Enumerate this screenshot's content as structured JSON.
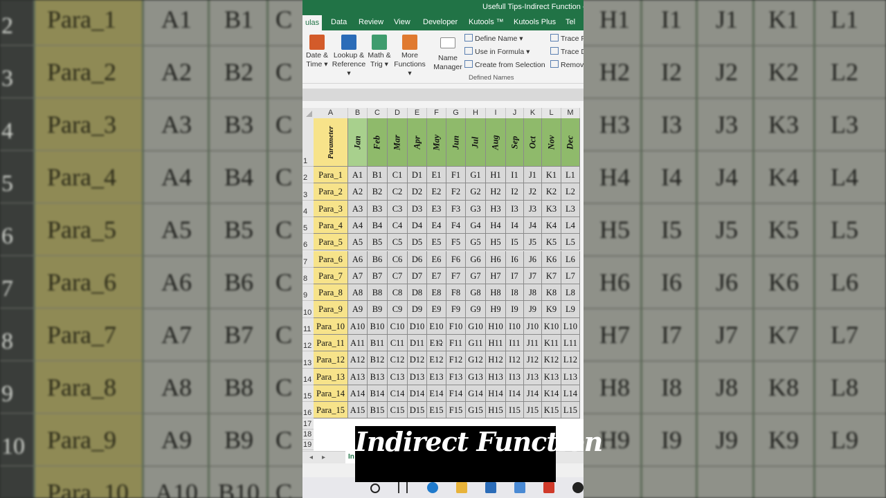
{
  "window": {
    "title": "Usefull Tips-Indirect Function - E"
  },
  "ribbon_tabs": [
    {
      "label": "ulas",
      "active": true
    },
    {
      "label": "Data"
    },
    {
      "label": "Review"
    },
    {
      "label": "View"
    },
    {
      "label": "Developer"
    },
    {
      "label": "Kutools ™"
    },
    {
      "label": "Kutools Plus"
    },
    {
      "label": "Tel"
    }
  ],
  "ribbon": {
    "buttons": [
      {
        "line1": "Date &",
        "line2": "Time ▾",
        "icon_color": "#d35b2a",
        "icon": "calendar-icon"
      },
      {
        "line1": "Lookup &",
        "line2": "Reference ▾",
        "icon_color": "#2b6cb8",
        "icon": "lookup-icon"
      },
      {
        "line1": "Math &",
        "line2": "Trig ▾",
        "icon_color": "#3f9c6e",
        "icon": "theta-icon"
      },
      {
        "line1": "More",
        "line2": "Functions ▾",
        "icon_color": "#e07a30",
        "icon": "more-icon"
      },
      {
        "line1": "Name",
        "line2": "Manager",
        "icon_color": "#8a8a8a",
        "icon": "tag-icon"
      }
    ],
    "small": [
      {
        "label": "Define Name ▾"
      },
      {
        "label": "Use in Formula ▾"
      },
      {
        "label": "Create from Selection"
      }
    ],
    "audit": [
      {
        "label": "Trace P"
      },
      {
        "label": "Trace D"
      },
      {
        "label": "Remov"
      }
    ],
    "group_label": "Defined Names"
  },
  "sheet": {
    "columns": [
      "A",
      "B",
      "C",
      "D",
      "E",
      "F",
      "G",
      "H",
      "I",
      "J",
      "K",
      "L",
      "M"
    ],
    "header_label": "Parameter",
    "months": [
      "Jan",
      "Feb",
      "Mar",
      "Apr",
      "May",
      "Jun",
      "Jul",
      "Aug",
      "Sep",
      "Oct",
      "Nov",
      "Dec"
    ],
    "row_numbers": [
      "1",
      "2",
      "3",
      "4",
      "5",
      "6",
      "7",
      "8",
      "9",
      "10",
      "11",
      "12",
      "13",
      "14",
      "15",
      "16",
      "17",
      "18",
      "19"
    ],
    "rows": [
      {
        "param": "Para_1",
        "cells": [
          "A1",
          "B1",
          "C1",
          "D1",
          "E1",
          "F1",
          "G1",
          "H1",
          "I1",
          "J1",
          "K1",
          "L1"
        ]
      },
      {
        "param": "Para_2",
        "cells": [
          "A2",
          "B2",
          "C2",
          "D2",
          "E2",
          "F2",
          "G2",
          "H2",
          "I2",
          "J2",
          "K2",
          "L2"
        ]
      },
      {
        "param": "Para_3",
        "cells": [
          "A3",
          "B3",
          "C3",
          "D3",
          "E3",
          "F3",
          "G3",
          "H3",
          "I3",
          "J3",
          "K3",
          "L3"
        ]
      },
      {
        "param": "Para_4",
        "cells": [
          "A4",
          "B4",
          "C4",
          "D4",
          "E4",
          "F4",
          "G4",
          "H4",
          "I4",
          "J4",
          "K4",
          "L4"
        ]
      },
      {
        "param": "Para_5",
        "cells": [
          "A5",
          "B5",
          "C5",
          "D5",
          "E5",
          "F5",
          "G5",
          "H5",
          "I5",
          "J5",
          "K5",
          "L5"
        ]
      },
      {
        "param": "Para_6",
        "cells": [
          "A6",
          "B6",
          "C6",
          "D6",
          "E6",
          "F6",
          "G6",
          "H6",
          "I6",
          "J6",
          "K6",
          "L6"
        ]
      },
      {
        "param": "Para_7",
        "cells": [
          "A7",
          "B7",
          "C7",
          "D7",
          "E7",
          "F7",
          "G7",
          "H7",
          "I7",
          "J7",
          "K7",
          "L7"
        ]
      },
      {
        "param": "Para_8",
        "cells": [
          "A8",
          "B8",
          "C8",
          "D8",
          "E8",
          "F8",
          "G8",
          "H8",
          "I8",
          "J8",
          "K8",
          "L8"
        ]
      },
      {
        "param": "Para_9",
        "cells": [
          "A9",
          "B9",
          "C9",
          "D9",
          "E9",
          "F9",
          "G9",
          "H9",
          "I9",
          "J9",
          "K9",
          "L9"
        ]
      },
      {
        "param": "Para_10",
        "cells": [
          "A10",
          "B10",
          "C10",
          "D10",
          "E10",
          "F10",
          "G10",
          "H10",
          "I10",
          "J10",
          "K10",
          "L10"
        ]
      },
      {
        "param": "Para_11",
        "cells": [
          "A11",
          "B11",
          "C11",
          "D11",
          "E11",
          "F11",
          "G11",
          "H11",
          "I11",
          "J11",
          "K11",
          "L11"
        ]
      },
      {
        "param": "Para_12",
        "cells": [
          "A12",
          "B12",
          "C12",
          "D12",
          "E12",
          "F12",
          "G12",
          "H12",
          "I12",
          "J12",
          "K12",
          "L12"
        ]
      },
      {
        "param": "Para_13",
        "cells": [
          "A13",
          "B13",
          "C13",
          "D13",
          "E13",
          "F13",
          "G13",
          "H13",
          "I13",
          "J13",
          "K13",
          "L13"
        ]
      },
      {
        "param": "Para_14",
        "cells": [
          "A14",
          "B14",
          "C14",
          "D14",
          "E14",
          "F14",
          "G14",
          "H14",
          "I14",
          "J14",
          "K14",
          "L14"
        ]
      },
      {
        "param": "Para_15",
        "cells": [
          "A15",
          "B15",
          "C15",
          "D15",
          "E15",
          "F15",
          "G15",
          "H15",
          "I15",
          "J15",
          "K15",
          "L15"
        ]
      }
    ],
    "sheet_tab": "In"
  },
  "background": {
    "left_rows": [
      {
        "num": "2",
        "param": "Para_1",
        "a": "A1",
        "b": "B1",
        "c": "C"
      },
      {
        "num": "3",
        "param": "Para_2",
        "a": "A2",
        "b": "B2",
        "c": "C"
      },
      {
        "num": "4",
        "param": "Para_3",
        "a": "A3",
        "b": "B3",
        "c": "C"
      },
      {
        "num": "5",
        "param": "Para_4",
        "a": "A4",
        "b": "B4",
        "c": "C"
      },
      {
        "num": "6",
        "param": "Para_5",
        "a": "A5",
        "b": "B5",
        "c": "C"
      },
      {
        "num": "7",
        "param": "Para_6",
        "a": "A6",
        "b": "B6",
        "c": "C"
      },
      {
        "num": "8",
        "param": "Para_7",
        "a": "A7",
        "b": "B7",
        "c": "C"
      },
      {
        "num": "9",
        "param": "Para_8",
        "a": "A8",
        "b": "B8",
        "c": "C"
      },
      {
        "num": "10",
        "param": "Para_9",
        "a": "A9",
        "b": "B9",
        "c": "C"
      },
      {
        "num": "",
        "param": "Para_10",
        "a": "A10",
        "b": "B10",
        "c": "C"
      }
    ],
    "right_rows": [
      [
        "H1",
        "I1",
        "J1",
        "K1",
        "L1"
      ],
      [
        "H2",
        "I2",
        "J2",
        "K2",
        "L2"
      ],
      [
        "H3",
        "I3",
        "J3",
        "K3",
        "L3"
      ],
      [
        "H4",
        "I4",
        "J4",
        "K4",
        "L4"
      ],
      [
        "H5",
        "I5",
        "J5",
        "K5",
        "L5"
      ],
      [
        "H6",
        "I6",
        "J6",
        "K6",
        "L6"
      ],
      [
        "H7",
        "I7",
        "J7",
        "K7",
        "L7"
      ],
      [
        "H8",
        "I8",
        "J8",
        "K8",
        "L8"
      ],
      [
        "H9",
        "I9",
        "J9",
        "K9",
        "L9"
      ]
    ]
  },
  "overlay": {
    "caption": "Indirect Function"
  },
  "taskbar": {
    "icons": [
      "search-icon",
      "task-view-icon",
      "edge-icon",
      "folder-icon",
      "mail-icon",
      "network-icon",
      "record-icon",
      "app-icon"
    ]
  },
  "colors": {
    "excel_green": "#217346",
    "param_yellow": "#f7e38a",
    "month_green": "#8fba6b",
    "data_gray": "#d9d9d9"
  }
}
